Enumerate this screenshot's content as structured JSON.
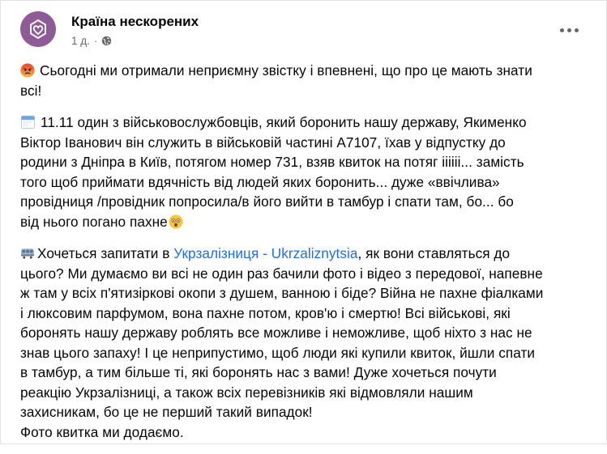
{
  "post": {
    "author": "Країна нескорених",
    "time": "1 д.",
    "visibility_icon": "globe-icon",
    "more_icon": "more-options-icon"
  },
  "paragraphs": {
    "p1": {
      "icon": "angry-face-icon",
      "lines": [
        "Сьогодні ми отримали неприємну звістку і впевнені, що про це мають знати",
        "всі!"
      ]
    },
    "p2": {
      "icon": "calendar-icon",
      "lines": [
        "11.11 один з військовослужбовців, який боронить нашу державу, Якименко",
        "Віктор Іванович він служить в військовій частині А7107, їхав у відпустку до",
        "родини з Дніпра в Київ, потягом номер 731, взяв квиток на потяг іііііі... замість",
        "того щоб приймати вдячність від людей яких боронить... дуже «ввічлива»",
        "провідниця /провідник попросила/в його вийти в тамбур і спати там, бо... бо",
        "від нього погано пахне"
      ],
      "end_icon": "astonished-face-icon"
    },
    "p3": {
      "icon": "train-icon",
      "first_prefix": "Хочеться запитати в ",
      "link": "Укрзалізниця - Ukrzaliznytsia",
      "first_suffix": ", як вони ставляться до",
      "lines": [
        "цього? Ми думаємо ви всі не один раз бачили фото і відео з передової, напевне",
        "ж там у всіх п'ятизіркові окопи з душем, ванною і біде? Війна не пахне фіалками",
        "і люксовим парфумом, вона пахне потом, кров'ю і смертю! Всі військові, які",
        "боронять нашу державу роблять все можливе і неможливе, щоб ніхто з нас не",
        "знав цього запаху! І це неприпустимо, щоб люди які купили квиток, йшли спати",
        "в тамбур, а тим більше ті, які боронять нас з вами! Дуже хочеться почути",
        "реакцію Укрзалізниці, а також всіх перевізників які відмовляли нашим",
        "захисникам, бо це не перший такий випадок!",
        "Фото квитка ми додаємо."
      ]
    }
  },
  "colors": {
    "text": "#050505",
    "meta": "#65676b",
    "link": "#216fdb",
    "avatar": "#8e5b97"
  }
}
